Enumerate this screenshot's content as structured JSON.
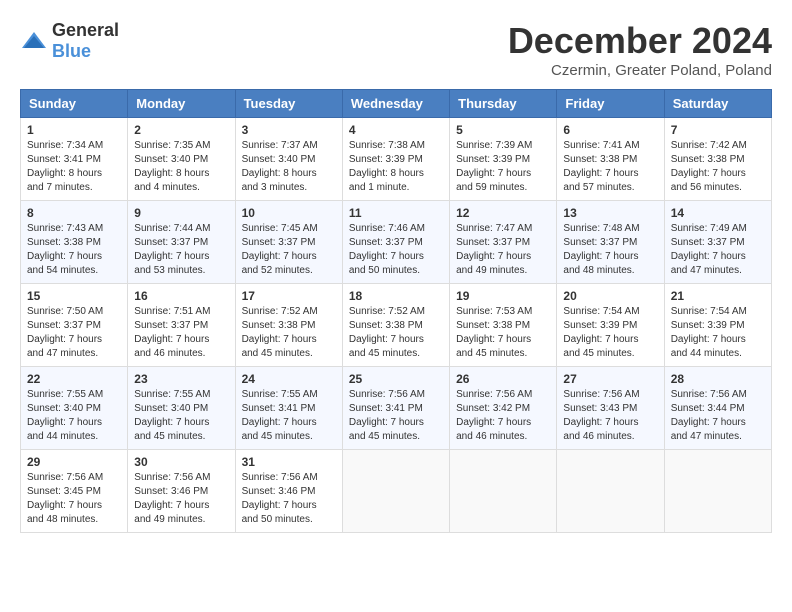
{
  "header": {
    "logo_general": "General",
    "logo_blue": "Blue",
    "title": "December 2024",
    "subtitle": "Czermin, Greater Poland, Poland"
  },
  "weekdays": [
    "Sunday",
    "Monday",
    "Tuesday",
    "Wednesday",
    "Thursday",
    "Friday",
    "Saturday"
  ],
  "weeks": [
    [
      {
        "day": "1",
        "sunrise": "7:34 AM",
        "sunset": "3:41 PM",
        "daylight": "8 hours and 7 minutes."
      },
      {
        "day": "2",
        "sunrise": "7:35 AM",
        "sunset": "3:40 PM",
        "daylight": "8 hours and 4 minutes."
      },
      {
        "day": "3",
        "sunrise": "7:37 AM",
        "sunset": "3:40 PM",
        "daylight": "8 hours and 3 minutes."
      },
      {
        "day": "4",
        "sunrise": "7:38 AM",
        "sunset": "3:39 PM",
        "daylight": "8 hours and 1 minute."
      },
      {
        "day": "5",
        "sunrise": "7:39 AM",
        "sunset": "3:39 PM",
        "daylight": "7 hours and 59 minutes."
      },
      {
        "day": "6",
        "sunrise": "7:41 AM",
        "sunset": "3:38 PM",
        "daylight": "7 hours and 57 minutes."
      },
      {
        "day": "7",
        "sunrise": "7:42 AM",
        "sunset": "3:38 PM",
        "daylight": "7 hours and 56 minutes."
      }
    ],
    [
      {
        "day": "8",
        "sunrise": "7:43 AM",
        "sunset": "3:38 PM",
        "daylight": "7 hours and 54 minutes."
      },
      {
        "day": "9",
        "sunrise": "7:44 AM",
        "sunset": "3:37 PM",
        "daylight": "7 hours and 53 minutes."
      },
      {
        "day": "10",
        "sunrise": "7:45 AM",
        "sunset": "3:37 PM",
        "daylight": "7 hours and 52 minutes."
      },
      {
        "day": "11",
        "sunrise": "7:46 AM",
        "sunset": "3:37 PM",
        "daylight": "7 hours and 50 minutes."
      },
      {
        "day": "12",
        "sunrise": "7:47 AM",
        "sunset": "3:37 PM",
        "daylight": "7 hours and 49 minutes."
      },
      {
        "day": "13",
        "sunrise": "7:48 AM",
        "sunset": "3:37 PM",
        "daylight": "7 hours and 48 minutes."
      },
      {
        "day": "14",
        "sunrise": "7:49 AM",
        "sunset": "3:37 PM",
        "daylight": "7 hours and 47 minutes."
      }
    ],
    [
      {
        "day": "15",
        "sunrise": "7:50 AM",
        "sunset": "3:37 PM",
        "daylight": "7 hours and 47 minutes."
      },
      {
        "day": "16",
        "sunrise": "7:51 AM",
        "sunset": "3:37 PM",
        "daylight": "7 hours and 46 minutes."
      },
      {
        "day": "17",
        "sunrise": "7:52 AM",
        "sunset": "3:38 PM",
        "daylight": "7 hours and 45 minutes."
      },
      {
        "day": "18",
        "sunrise": "7:52 AM",
        "sunset": "3:38 PM",
        "daylight": "7 hours and 45 minutes."
      },
      {
        "day": "19",
        "sunrise": "7:53 AM",
        "sunset": "3:38 PM",
        "daylight": "7 hours and 45 minutes."
      },
      {
        "day": "20",
        "sunrise": "7:54 AM",
        "sunset": "3:39 PM",
        "daylight": "7 hours and 45 minutes."
      },
      {
        "day": "21",
        "sunrise": "7:54 AM",
        "sunset": "3:39 PM",
        "daylight": "7 hours and 44 minutes."
      }
    ],
    [
      {
        "day": "22",
        "sunrise": "7:55 AM",
        "sunset": "3:40 PM",
        "daylight": "7 hours and 44 minutes."
      },
      {
        "day": "23",
        "sunrise": "7:55 AM",
        "sunset": "3:40 PM",
        "daylight": "7 hours and 45 minutes."
      },
      {
        "day": "24",
        "sunrise": "7:55 AM",
        "sunset": "3:41 PM",
        "daylight": "7 hours and 45 minutes."
      },
      {
        "day": "25",
        "sunrise": "7:56 AM",
        "sunset": "3:41 PM",
        "daylight": "7 hours and 45 minutes."
      },
      {
        "day": "26",
        "sunrise": "7:56 AM",
        "sunset": "3:42 PM",
        "daylight": "7 hours and 46 minutes."
      },
      {
        "day": "27",
        "sunrise": "7:56 AM",
        "sunset": "3:43 PM",
        "daylight": "7 hours and 46 minutes."
      },
      {
        "day": "28",
        "sunrise": "7:56 AM",
        "sunset": "3:44 PM",
        "daylight": "7 hours and 47 minutes."
      }
    ],
    [
      {
        "day": "29",
        "sunrise": "7:56 AM",
        "sunset": "3:45 PM",
        "daylight": "7 hours and 48 minutes."
      },
      {
        "day": "30",
        "sunrise": "7:56 AM",
        "sunset": "3:46 PM",
        "daylight": "7 hours and 49 minutes."
      },
      {
        "day": "31",
        "sunrise": "7:56 AM",
        "sunset": "3:46 PM",
        "daylight": "7 hours and 50 minutes."
      },
      null,
      null,
      null,
      null
    ]
  ]
}
